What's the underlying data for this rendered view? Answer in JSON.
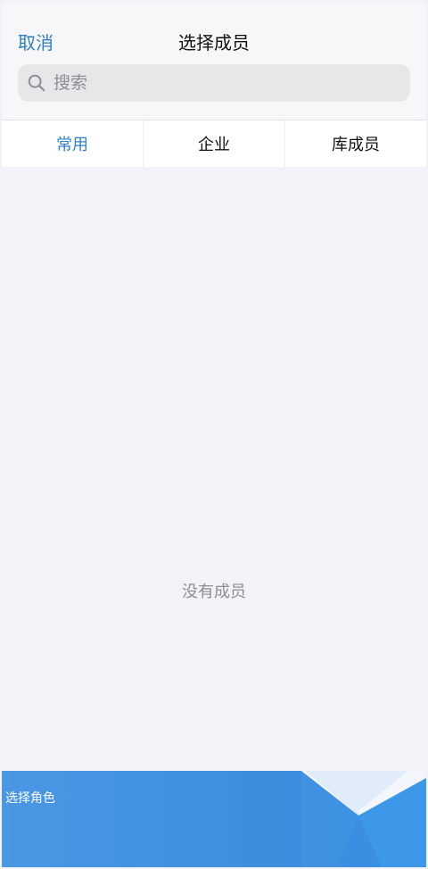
{
  "header": {
    "cancel_label": "取消",
    "title": "选择成员"
  },
  "search": {
    "placeholder": "搜索",
    "value": ""
  },
  "tabs": [
    {
      "label": "常用",
      "active": true
    },
    {
      "label": "企业",
      "active": false
    },
    {
      "label": "库成员",
      "active": false
    }
  ],
  "content": {
    "empty_text": "没有成员"
  },
  "bottom": {
    "label": "选择角色"
  },
  "colors": {
    "accent": "#2f82c6",
    "background": "#f2f2f7",
    "bottom_bar": "#4a97e4"
  },
  "icons": {
    "search": "search-icon"
  }
}
